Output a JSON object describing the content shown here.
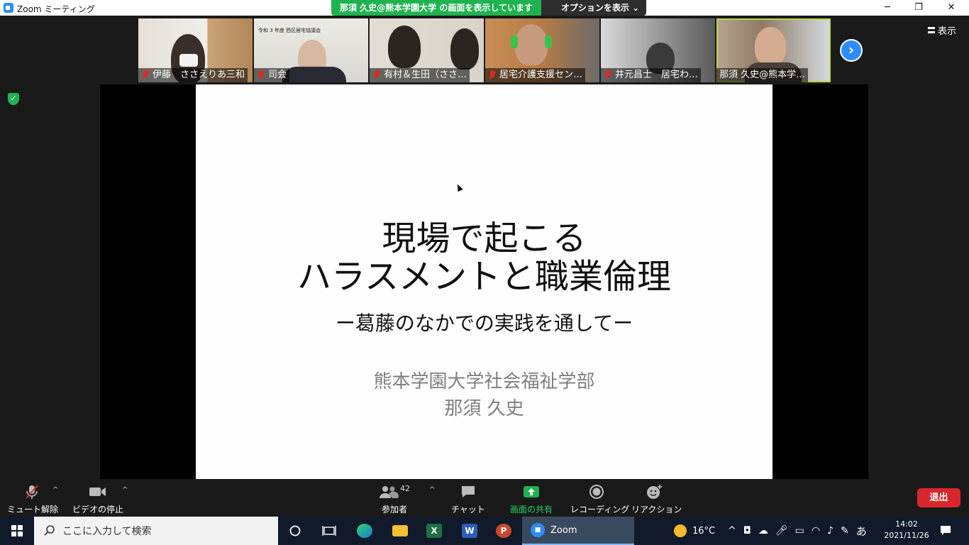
{
  "window": {
    "title": "Zoom ミーティング",
    "minimize": "─",
    "restore": "❐",
    "close": "✕"
  },
  "share_banner": {
    "text": "那須 久史@熊本学園大学 の画面を表示しています",
    "options_label": "オプションを表示 ⌄"
  },
  "participants": [
    {
      "name": "伊藤　ささえりあ三和"
    },
    {
      "name": "司会"
    },
    {
      "name": "有村＆生田（ささ…"
    },
    {
      "name": "居宅介護支援セン…"
    },
    {
      "name": "井元昌士　居宅わ…"
    },
    {
      "name": "那須 久史@熊本学…"
    }
  ],
  "tile2_sign": "令和 3 年度  西区居宅協議会",
  "view_label": "表示",
  "slide": {
    "title_line1": "現場で起こる",
    "title_line2": "ハラスメントと職業倫理",
    "subtitle": "ー葛藤のなかでの実践を通してー",
    "organization": "熊本学園大学社会福祉学部",
    "author": "那須 久史"
  },
  "toolbar": {
    "unmute": "ミュート解除",
    "stop_video": "ビデオの停止",
    "participants": "参加者",
    "participant_count": "42",
    "chat": "チャット",
    "share_screen": "画面の共有",
    "recording": "レコーディング",
    "reactions": "リアクション",
    "leave": "退出"
  },
  "taskbar": {
    "search_placeholder": "ここに入力して検索",
    "zoom_label": "Zoom",
    "temperature": "16°C",
    "ime": "あ",
    "time": "14:02",
    "date": "2021/11/26"
  },
  "colors": {
    "zoom_blue": "#2d8cff",
    "share_green": "#1fb350",
    "leave_red": "#d9272e",
    "muted_red": "#e02828",
    "active_speaker": "#b8d84a"
  }
}
